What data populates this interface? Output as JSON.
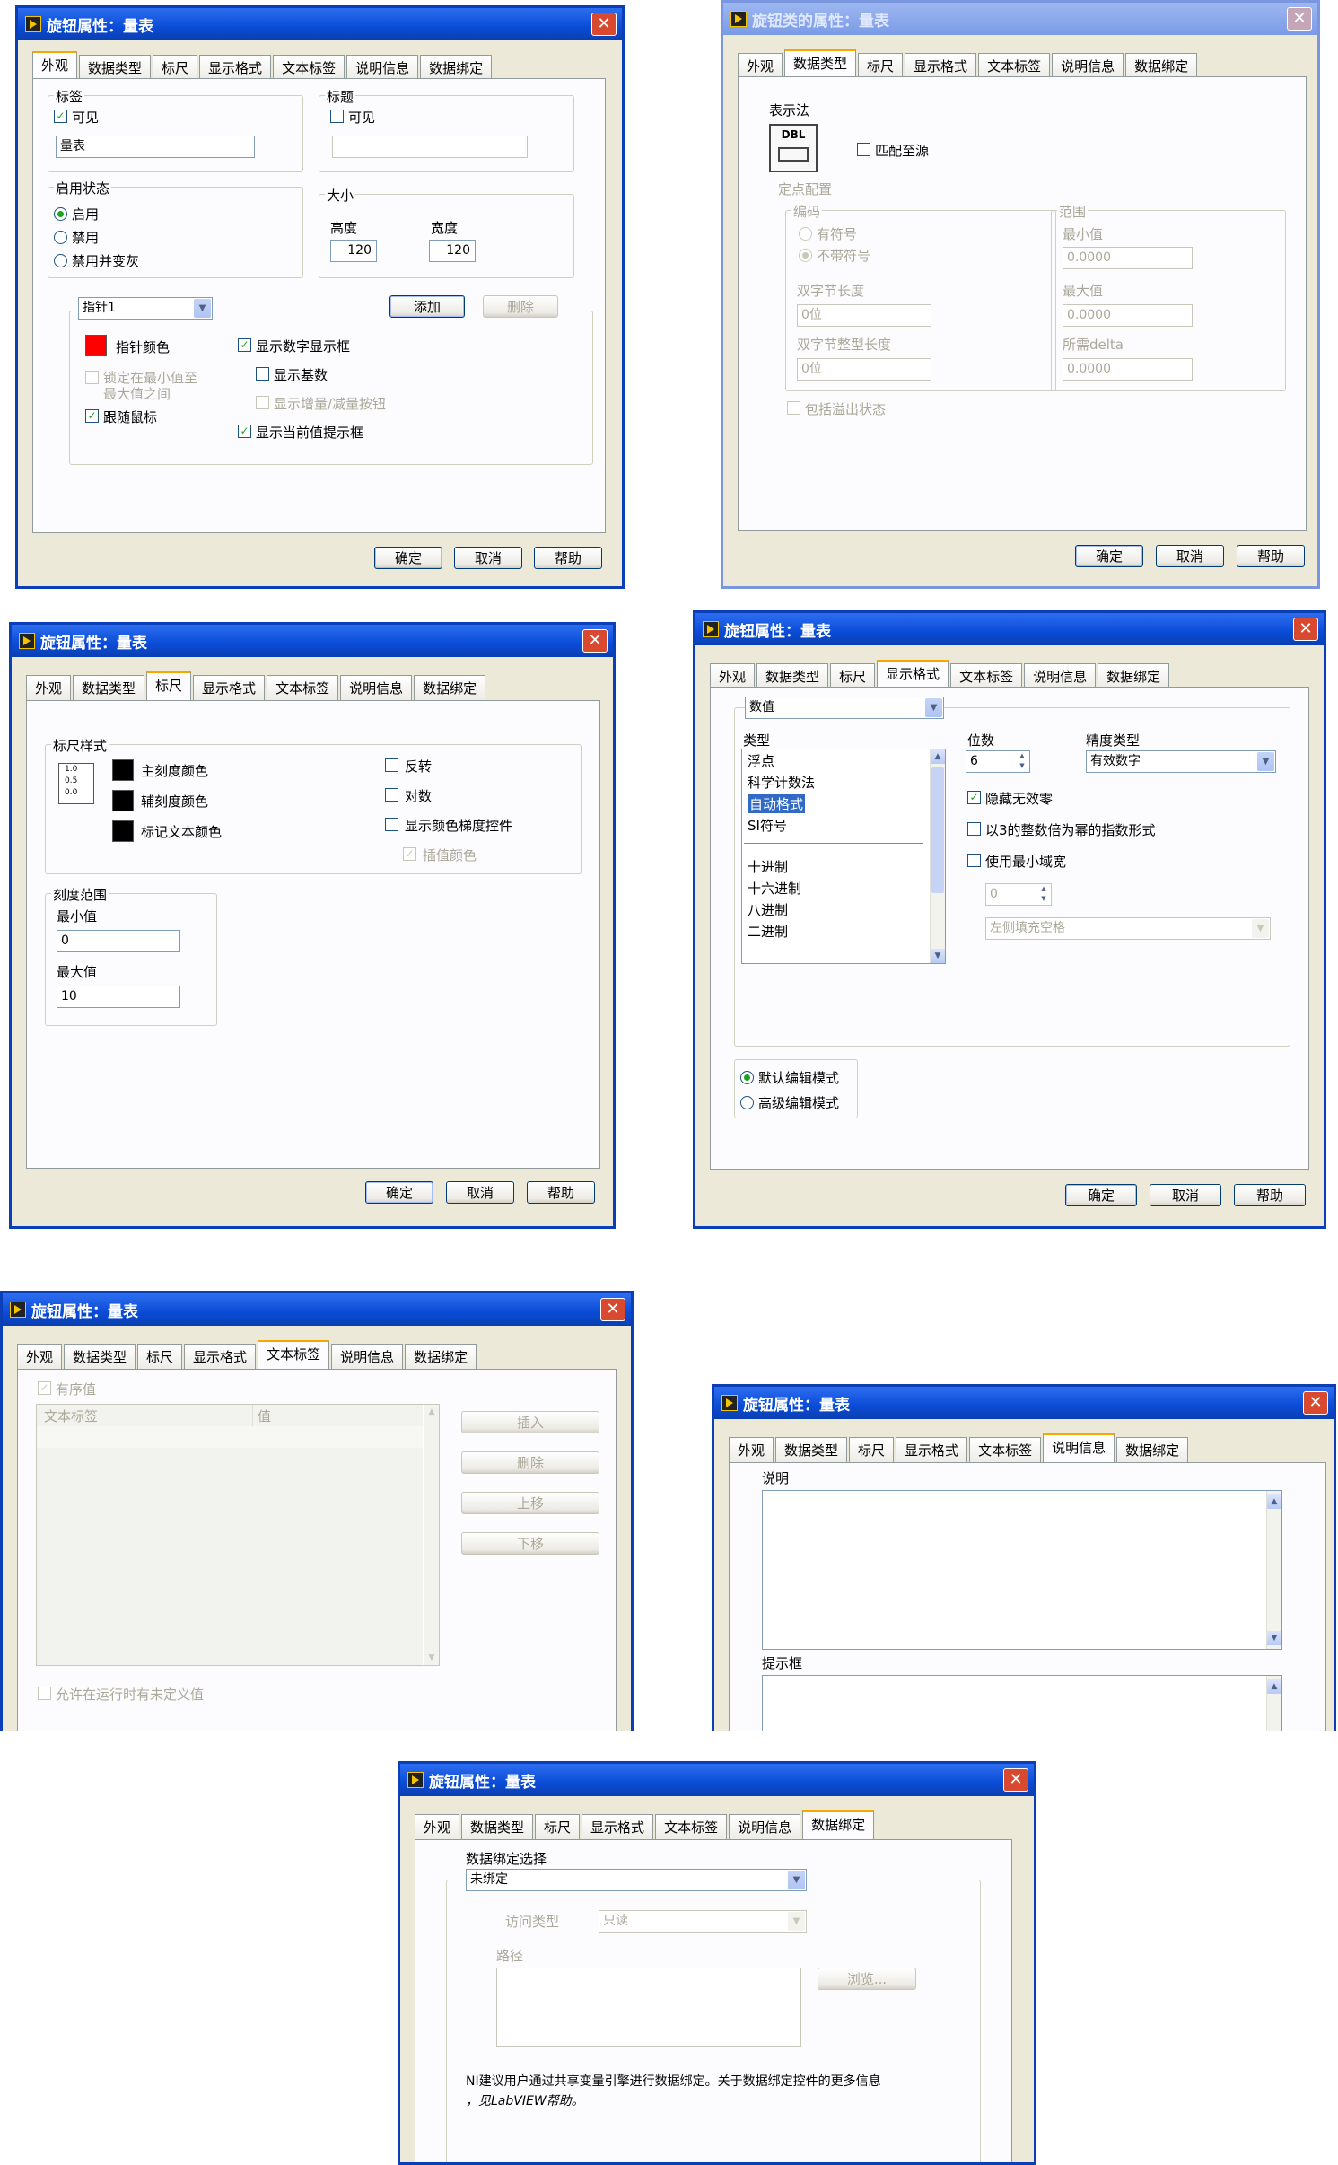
{
  "common": {
    "tabs": [
      "外观",
      "数据类型",
      "标尺",
      "显示格式",
      "文本标签",
      "说明信息",
      "数据绑定"
    ],
    "buttons": {
      "ok": "确定",
      "cancel": "取消",
      "help": "帮助"
    }
  },
  "w1": {
    "title": "旋钮属性：量表",
    "label": {
      "group": "标签",
      "visible": "可见",
      "value": "量表"
    },
    "caption": {
      "group": "标题",
      "visible": "可见",
      "value": ""
    },
    "state": {
      "group": "启用状态",
      "enabled": "启用",
      "disabled": "禁用",
      "disabled_grayed": "禁用并变灰"
    },
    "size": {
      "group": "大小",
      "height_label": "高度",
      "width_label": "宽度",
      "height": "120",
      "width": "120"
    },
    "needle": {
      "select": "指针1",
      "add": "添加",
      "delete": "删除",
      "color_label": "指针颜色",
      "color": "#ff0000",
      "lock_line1": "锁定在最小值至",
      "lock_line2": "最大值之间",
      "follow_mouse": "跟随鼠标",
      "show_digital": "显示数字显示框",
      "show_radix": "显示基数",
      "show_incdec": "显示增量/减量按钮",
      "show_tip": "显示当前值提示框"
    }
  },
  "w2": {
    "title": "旋钮类的属性：量表",
    "repr": "表示法",
    "dbl": "DBL",
    "adapt": "匹配至源",
    "fixed": "定点配置",
    "encoding": "编码",
    "signed": "有符号",
    "unsigned": "不带符号",
    "word_len": "双字节长度",
    "word_val": "0位",
    "int_len": "双字节整型长度",
    "int_val": "0位",
    "range": "范围",
    "min": "最小值",
    "min_val": "0.0000",
    "max": "最大值",
    "max_val": "0.0000",
    "delta": "所需delta",
    "delta_val": "0.0000",
    "overflow": "包括溢出状态"
  },
  "w3": {
    "title": "旋钮属性：量表",
    "style": "标尺样式",
    "icon_lines": [
      "1.0",
      "0.5",
      "0.0"
    ],
    "major": "主刻度颜色",
    "minor": "辅刻度颜色",
    "marker": "标记文本颜色",
    "invert": "反转",
    "log": "对数",
    "ramp": "显示颜色梯度控件",
    "interp": "插值颜色",
    "range": "刻度范围",
    "min": "最小值",
    "min_val": "0",
    "max": "最大值",
    "max_val": "10"
  },
  "w4": {
    "title": "旋钮属性：量表",
    "type_select": "数值",
    "type_label": "类型",
    "types_a": [
      "浮点",
      "科学计数法",
      "自动格式",
      "SI符号"
    ],
    "types_b": [
      "十进制",
      "十六进制",
      "八进制",
      "二进制"
    ],
    "digits_label": "位数",
    "digits": "6",
    "prec_label": "精度类型",
    "prec": "有效数字",
    "hide_zero": "隐藏无效零",
    "exp3": "以3的整数倍为幂的指数形式",
    "min_width": "使用最小域宽",
    "min_width_val": "0",
    "pad": "左侧填充空格",
    "default_mode": "默认编辑模式",
    "advanced_mode": "高级编辑模式"
  },
  "w5": {
    "title": "旋钮属性：量表",
    "ordered": "有序值",
    "col_text": "文本标签",
    "col_value": "值",
    "insert": "插入",
    "delete": "删除",
    "up": "上移",
    "down": "下移",
    "allow": "允许在运行时有未定义值"
  },
  "w6": {
    "title": "旋钮属性：量表",
    "desc": "说明",
    "tip": "提示框"
  },
  "w7": {
    "title": "旋钮属性：量表",
    "bind_label": "数据绑定选择",
    "bind_value": "未绑定",
    "access_label": "访问类型",
    "access_value": "只读",
    "path_label": "路径",
    "browse": "浏览...",
    "note1": "NI建议用户通过共享变量引擎进行数据绑定。关于数据绑定控件的更多信息",
    "note2": "，见LabVIEW帮助。"
  }
}
